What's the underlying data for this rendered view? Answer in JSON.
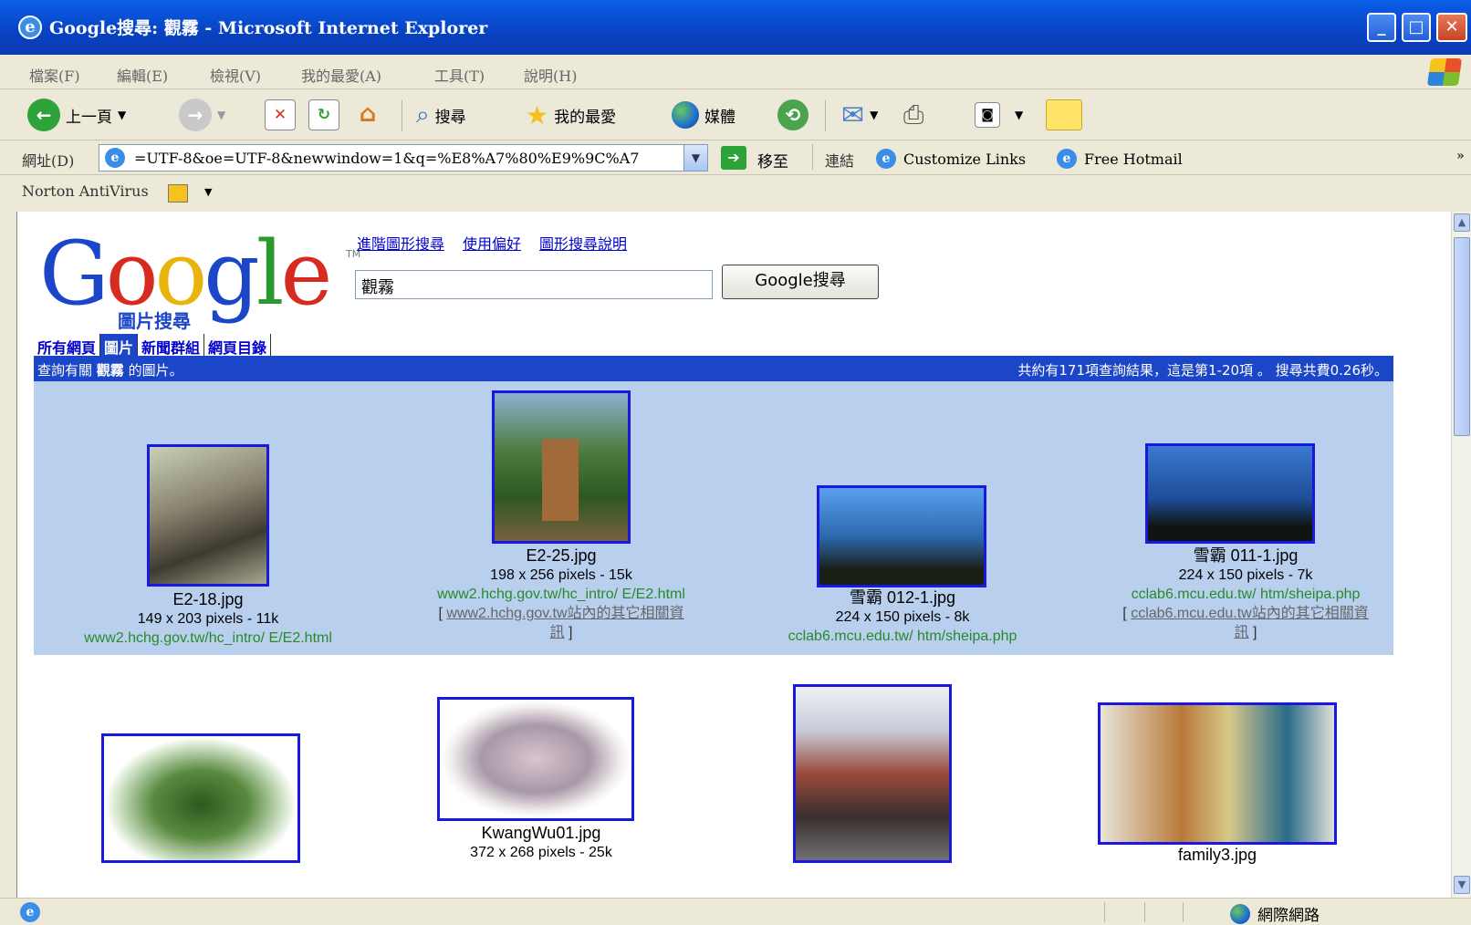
{
  "window": {
    "title": "Google搜尋: 觀霧 - Microsoft Internet Explorer"
  },
  "menu": [
    "檔案(F)",
    "編輯(E)",
    "檢視(V)",
    "我的最愛(A)",
    "工具(T)",
    "說明(H)"
  ],
  "toolbar": {
    "back_label": "上一頁",
    "search_label": "搜尋",
    "favorites_label": "我的最愛",
    "media_label": "媒體"
  },
  "address": {
    "label": "網址(D)",
    "value": "=UTF-8&oe=UTF-8&newwindow=1&q=%E8%A7%80%E9%9C%A7",
    "go_label": "移至",
    "links_label": "連結",
    "link1": "Customize Links",
    "link2": "Free Hotmail"
  },
  "norton": {
    "label": "Norton AntiVirus"
  },
  "page": {
    "logo_sub": "圖片搜尋",
    "tm": "TM",
    "links": [
      "進階圖形搜尋",
      "使用偏好",
      "圖形搜尋說明"
    ],
    "query": "觀霧",
    "search_button": "Google搜尋",
    "tabs": [
      "所有網頁",
      "圖片",
      "新聞群組",
      "網頁目錄"
    ],
    "info_left_prefix": "查詢有關",
    "info_left_query": "觀霧",
    "info_left_suffix": "的圖片。",
    "info_right": "共約有171項查詢結果，這是第1-20項 。 搜尋共費0.26秒。"
  },
  "results": [
    {
      "name": "E2-18.jpg",
      "size": "149 x 203 pixels - 11k",
      "url": "www2.hchg.gov.tw/hc_intro/ E/E2.html",
      "more": ""
    },
    {
      "name": "E2-25.jpg",
      "size": "198 x 256 pixels - 15k",
      "url": "www2.hchg.gov.tw/hc_intro/ E/E2.html",
      "more_link": "www2.hchg.gov.tw站內的其它相關資",
      "more_tail": "訊"
    },
    {
      "name": "雪霸 012-1.jpg",
      "size": "224 x 150 pixels - 8k",
      "url": "cclab6.mcu.edu.tw/ htm/sheipa.php",
      "more": ""
    },
    {
      "name": "雪霸 011-1.jpg",
      "size": "224 x 150 pixels - 7k",
      "url": "cclab6.mcu.edu.tw/ htm/sheipa.php",
      "more_link": "cclab6.mcu.edu.tw站內的其它相關資",
      "more_tail": "訊"
    },
    {
      "name": "",
      "size": "",
      "url": ""
    },
    {
      "name": "KwangWu01.jpg",
      "size": "372 x 268 pixels - 25k",
      "url": ""
    },
    {
      "name": "",
      "size": "",
      "url": ""
    },
    {
      "name": "family3.jpg",
      "size": "",
      "url": ""
    }
  ],
  "status": {
    "zone": "網際網路"
  },
  "colors": {
    "titlebar": "#0842c2",
    "google_blue": "#1c46c8",
    "result_bg": "#b8cfee",
    "url_green": "#2a8a2a"
  }
}
